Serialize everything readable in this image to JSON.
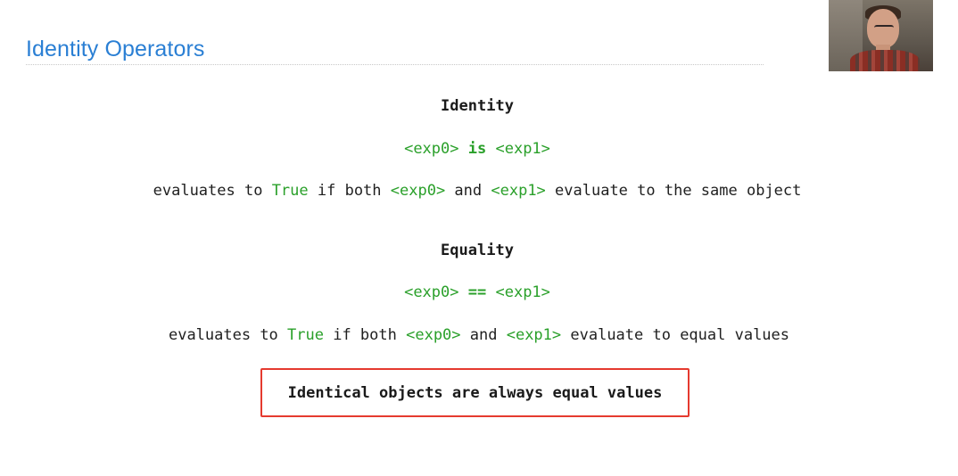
{
  "slide": {
    "title": "Identity Operators"
  },
  "identity": {
    "heading": "Identity",
    "expr_left": "<exp0>",
    "expr_op": "is",
    "expr_right": "<exp1>",
    "desc_pre": "evaluates to ",
    "desc_true": "True",
    "desc_mid1": " if both ",
    "desc_exp0": "<exp0>",
    "desc_mid2": " and ",
    "desc_exp1": "<exp1>",
    "desc_post": " evaluate to the same object"
  },
  "equality": {
    "heading": "Equality",
    "expr_left": "<exp0>",
    "expr_op": "==",
    "expr_right": "<exp1>",
    "desc_pre": "evaluates to ",
    "desc_true": "True",
    "desc_mid1": " if both ",
    "desc_exp0": "<exp0>",
    "desc_mid2": " and ",
    "desc_exp1": "<exp1>",
    "desc_post": " evaluate to equal values"
  },
  "callout": {
    "text": "Identical objects are always equal values",
    "border_color": "#e53a2f"
  },
  "colors": {
    "title": "#2a7fd4",
    "code_green": "#2aa02a"
  },
  "webcam": {
    "icon": "presenter-video-icon"
  }
}
